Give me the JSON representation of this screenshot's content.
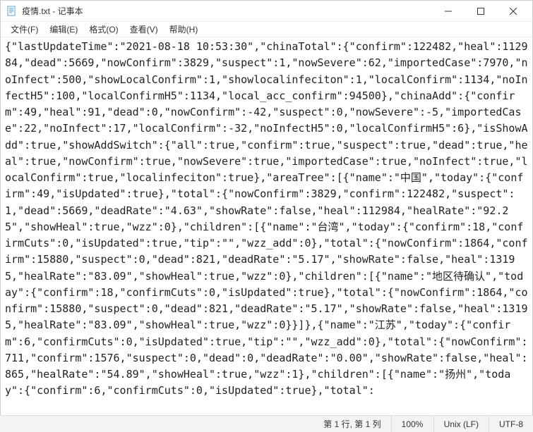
{
  "window": {
    "title": "疫情.txt - 记事本"
  },
  "menu": {
    "file": "文件(F)",
    "edit": "编辑(E)",
    "format": "格式(O)",
    "view": "查看(V)",
    "help": "帮助(H)"
  },
  "content": {
    "text": "{\"lastUpdateTime\":\"2021-08-18 10:53:30\",\"chinaTotal\":{\"confirm\":122482,\"heal\":112984,\"dead\":5669,\"nowConfirm\":3829,\"suspect\":1,\"nowSevere\":62,\"importedCase\":7970,\"noInfect\":500,\"showLocalConfirm\":1,\"showlocalinfeciton\":1,\"localConfirm\":1134,\"noInfectH5\":100,\"localConfirmH5\":1134,\"local_acc_confirm\":94500},\"chinaAdd\":{\"confirm\":49,\"heal\":91,\"dead\":0,\"nowConfirm\":-42,\"suspect\":0,\"nowSevere\":-5,\"importedCase\":22,\"noInfect\":17,\"localConfirm\":-32,\"noInfectH5\":0,\"localConfirmH5\":6},\"isShowAdd\":true,\"showAddSwitch\":{\"all\":true,\"confirm\":true,\"suspect\":true,\"dead\":true,\"heal\":true,\"nowConfirm\":true,\"nowSevere\":true,\"importedCase\":true,\"noInfect\":true,\"localConfirm\":true,\"localinfeciton\":true},\"areaTree\":[{\"name\":\"中国\",\"today\":{\"confirm\":49,\"isUpdated\":true},\"total\":{\"nowConfirm\":3829,\"confirm\":122482,\"suspect\":1,\"dead\":5669,\"deadRate\":\"4.63\",\"showRate\":false,\"heal\":112984,\"healRate\":\"92.25\",\"showHeal\":true,\"wzz\":0},\"children\":[{\"name\":\"台湾\",\"today\":{\"confirm\":18,\"confirmCuts\":0,\"isUpdated\":true,\"tip\":\"\",\"wzz_add\":0},\"total\":{\"nowConfirm\":1864,\"confirm\":15880,\"suspect\":0,\"dead\":821,\"deadRate\":\"5.17\",\"showRate\":false,\"heal\":13195,\"healRate\":\"83.09\",\"showHeal\":true,\"wzz\":0},\"children\":[{\"name\":\"地区待确认\",\"today\":{\"confirm\":18,\"confirmCuts\":0,\"isUpdated\":true},\"total\":{\"nowConfirm\":1864,\"confirm\":15880,\"suspect\":0,\"dead\":821,\"deadRate\":\"5.17\",\"showRate\":false,\"heal\":13195,\"healRate\":\"83.09\",\"showHeal\":true,\"wzz\":0}}]},{\"name\":\"江苏\",\"today\":{\"confirm\":6,\"confirmCuts\":0,\"isUpdated\":true,\"tip\":\"\",\"wzz_add\":0},\"total\":{\"nowConfirm\":711,\"confirm\":1576,\"suspect\":0,\"dead\":0,\"deadRate\":\"0.00\",\"showRate\":false,\"heal\":865,\"healRate\":\"54.89\",\"showHeal\":true,\"wzz\":1},\"children\":[{\"name\":\"扬州\",\"today\":{\"confirm\":6,\"confirmCuts\":0,\"isUpdated\":true},\"total\":"
  },
  "statusbar": {
    "position": "第 1 行, 第 1 列",
    "zoom": "100%",
    "line_ending": "Unix (LF)",
    "encoding": "UTF-8"
  }
}
